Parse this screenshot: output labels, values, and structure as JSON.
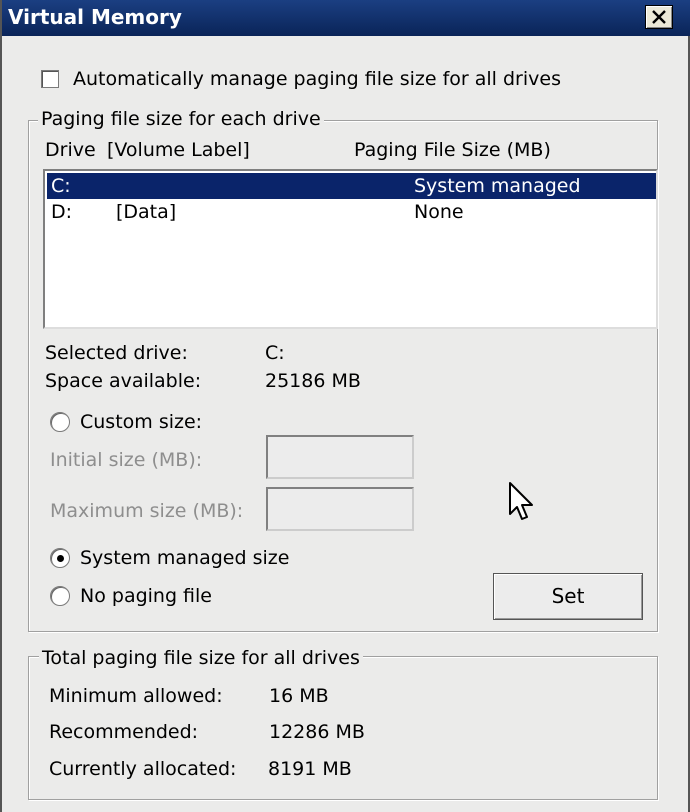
{
  "window": {
    "title": "Virtual Memory"
  },
  "auto_manage": {
    "label": "Automatically manage paging file size for all drives",
    "checked": false
  },
  "per_drive_group": {
    "legend": "Paging file size for each drive",
    "columns": {
      "drive": "Drive",
      "volume_label": "[Volume Label]",
      "size": "Paging File Size (MB)"
    },
    "drives": [
      {
        "drive": "C:",
        "label": "",
        "size": "System managed",
        "selected": true
      },
      {
        "drive": "D:",
        "label": "[Data]",
        "size": "None",
        "selected": false
      }
    ],
    "selected_drive_label": "Selected drive:",
    "selected_drive_value": "C:",
    "space_available_label": "Space available:",
    "space_available_value": "25186 MB",
    "custom_size_label": "Custom size:",
    "initial_size_label": "Initial size (MB):",
    "initial_size_value": "",
    "maximum_size_label": "Maximum size (MB):",
    "maximum_size_value": "",
    "system_managed_label": "System managed size",
    "no_paging_label": "No paging file",
    "selected_option": "system_managed",
    "set_button": "Set"
  },
  "totals_group": {
    "legend": "Total paging file size for all drives",
    "minimum_label": "Minimum allowed:",
    "minimum_value": "16 MB",
    "recommended_label": "Recommended:",
    "recommended_value": "12286 MB",
    "allocated_label": "Currently allocated:",
    "allocated_value": "8191 MB"
  },
  "icons": {
    "close": "close-icon",
    "cursor": "mouse-pointer-icon"
  }
}
